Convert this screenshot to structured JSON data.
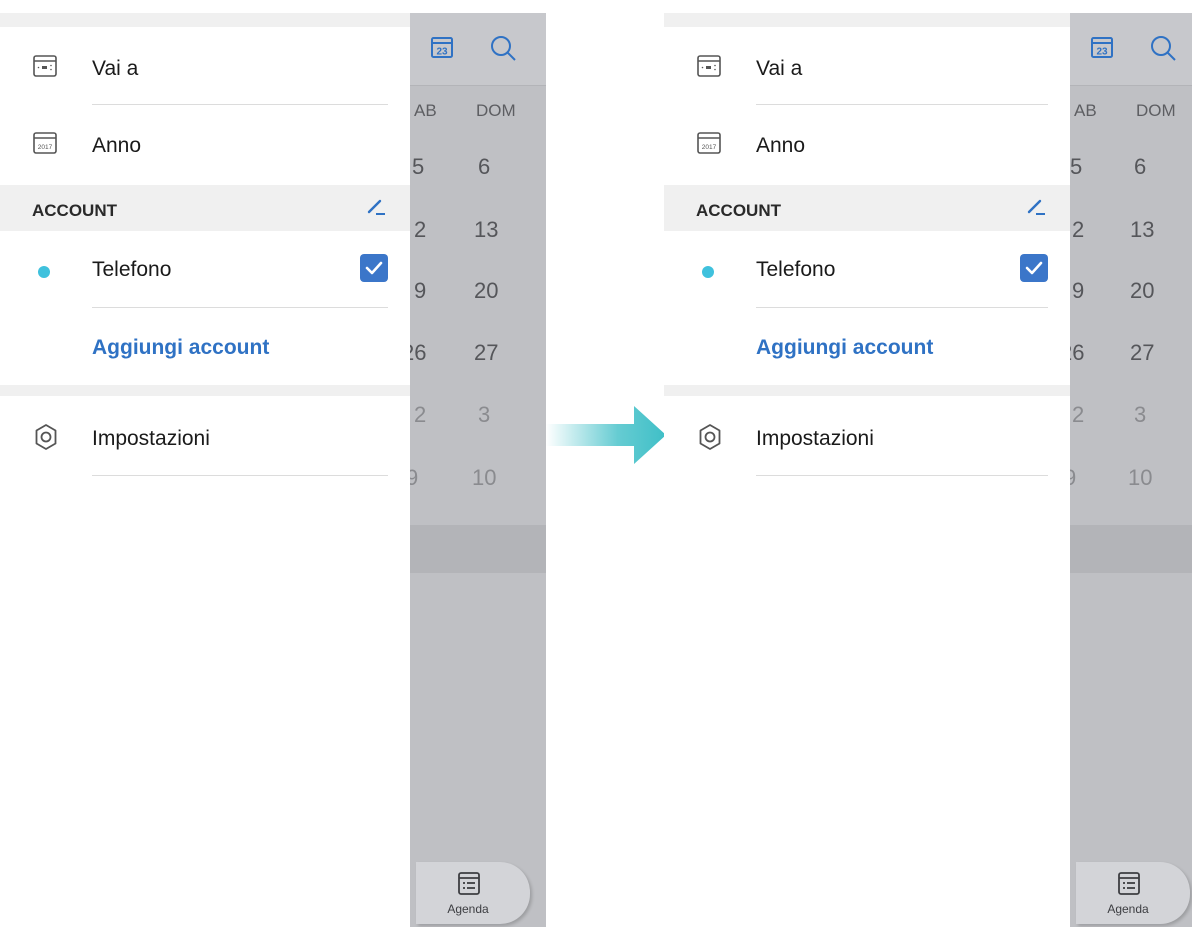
{
  "screens": [
    {
      "calendar": {
        "weekdays": [
          "AB",
          "DOM"
        ],
        "rows": [
          [
            "5",
            "6"
          ],
          [
            "2",
            "13"
          ],
          [
            "9",
            "20"
          ],
          [
            "26",
            "27"
          ],
          [
            "2",
            "3"
          ],
          [
            "9",
            "10"
          ]
        ],
        "today_icon_number": "23",
        "agenda_label": "Agenda"
      },
      "drawer": {
        "goto_label": "Vai a",
        "year_label": "Anno",
        "year_icon_text": "2017",
        "account_header": "ACCOUNT",
        "phone_account_label": "Telefono",
        "add_account_label": "Aggiungi account",
        "settings_label": "Impostazioni"
      }
    },
    {
      "calendar": {
        "weekdays": [
          "AB",
          "DOM"
        ],
        "rows": [
          [
            "5",
            "6"
          ],
          [
            "2",
            "13"
          ],
          [
            "9",
            "20"
          ],
          [
            "26",
            "27"
          ],
          [
            "2",
            "3"
          ],
          [
            "9",
            "10"
          ]
        ],
        "today_icon_number": "23",
        "agenda_label": "Agenda"
      },
      "drawer": {
        "goto_label": "Vai a",
        "year_label": "Anno",
        "year_icon_text": "2017",
        "account_header": "ACCOUNT",
        "phone_account_label": "Telefono",
        "add_account_label": "Aggiungi account",
        "settings_label": "Impostazioni"
      }
    }
  ],
  "colors": {
    "accent_blue": "#2f72c4",
    "checkbox_blue": "#3b76c9",
    "account_dot": "#3fc1dd",
    "arrow_teal": "#3fbfc7"
  }
}
